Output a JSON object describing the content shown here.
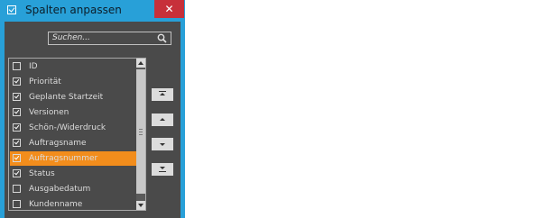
{
  "window": {
    "title": "Spalten anpassen",
    "close_label": "✕"
  },
  "search": {
    "placeholder": "Suchen..."
  },
  "columns": [
    {
      "label": "ID",
      "checked": false
    },
    {
      "label": "Priorität",
      "checked": true
    },
    {
      "label": "Geplante Startzeit",
      "checked": true
    },
    {
      "label": "Versionen",
      "checked": true
    },
    {
      "label": "Schön-/Widerdruck",
      "checked": true
    },
    {
      "label": "Auftragsname",
      "checked": true
    },
    {
      "label": "Auftragsnummer",
      "checked": true,
      "selected": true
    },
    {
      "label": "Status",
      "checked": true
    },
    {
      "label": "Ausgabedatum",
      "checked": false
    },
    {
      "label": "Kundenname",
      "checked": false
    }
  ],
  "colors": {
    "titlebar": "#28a0d8",
    "panel": "#4a4a4a",
    "selection": "#f28d1c",
    "close": "#c7303a"
  }
}
